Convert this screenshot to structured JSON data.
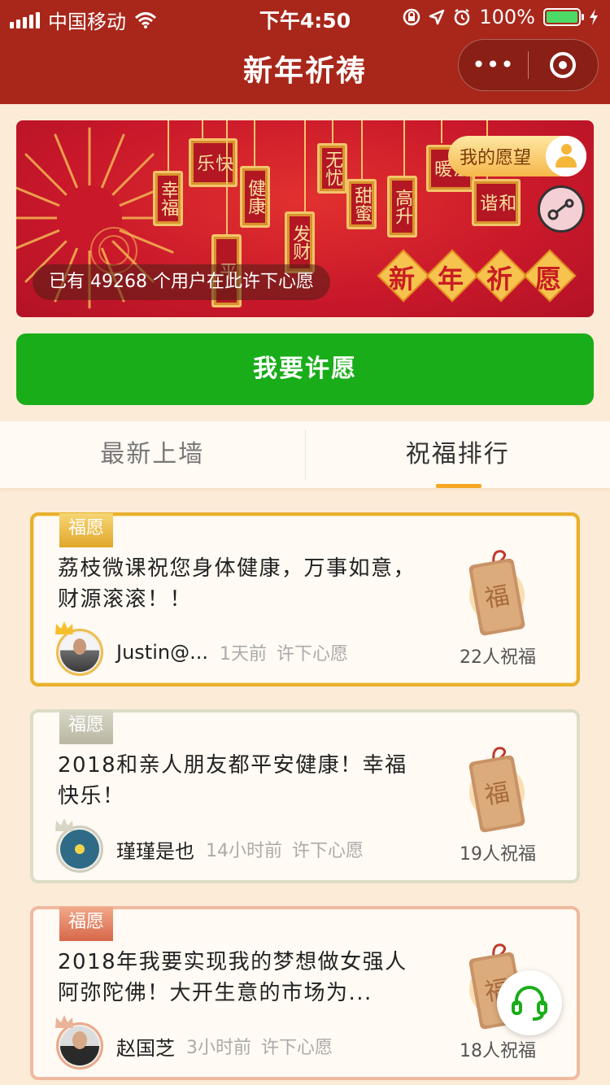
{
  "status_bar": {
    "carrier": "中国移动",
    "time": "下午4:50",
    "battery": "100%"
  },
  "nav": {
    "title": "新年祈祷",
    "more_label": "•••"
  },
  "banner": {
    "tags": [
      "快乐",
      "幸福",
      "健康",
      "平",
      "发财",
      "无忧",
      "甜蜜",
      "高升",
      "温暖",
      "和谐"
    ],
    "my_wish_label": "我的愿望",
    "count_text": "已有 49268 个用户在此许下心愿",
    "title_chars": [
      "新",
      "年",
      "祈",
      "愿"
    ]
  },
  "main_button": {
    "label": "我要许愿"
  },
  "tabs": [
    {
      "label": "最新上墙",
      "active": false
    },
    {
      "label": "祝福排行",
      "active": true
    }
  ],
  "cards": [
    {
      "rank": "gold",
      "ribbon": "福愿",
      "text": "荔枝微课祝您身体健康，万事如意，财源滚滚！！",
      "name": "Justin@...",
      "time": "1天前",
      "action": "许下心愿",
      "bless": "22人祝福"
    },
    {
      "rank": "silver",
      "ribbon": "福愿",
      "text": "2018和亲人朋友都平安健康！幸福快乐！",
      "name": "瑾瑾是也",
      "time": "14小时前",
      "action": "许下心愿",
      "bless": "19人祝福"
    },
    {
      "rank": "bronze",
      "ribbon": "福愿",
      "text": "2018年我要实现我的梦想做女强人阿弥陀佛！大开生意的市场为...",
      "name": "赵国芝",
      "time": "3小时前",
      "action": "许下心愿",
      "bless": "18人祝福"
    }
  ],
  "fu_char": "福",
  "colors": {
    "nav_bg": "#a8271a",
    "primary_green": "#19ad19",
    "tab_indicator": "#f5a623",
    "page_bg": "#fcebd6"
  }
}
